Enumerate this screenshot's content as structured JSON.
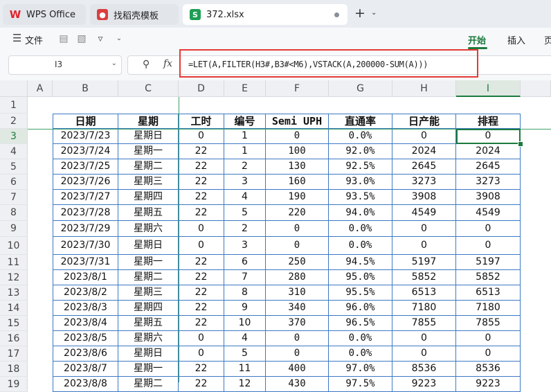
{
  "tabs": {
    "wps": {
      "label": "WPS Office",
      "icon": "wps-logo-icon"
    },
    "daoke": {
      "label": "找稻壳模板",
      "icon": "daoke-icon"
    },
    "file": {
      "label": "372.xlsx",
      "icon_letter": "S"
    }
  },
  "menu": {
    "file": "文件",
    "start": "开始",
    "insert": "插入",
    "page": "页"
  },
  "formula_bar": {
    "cell_ref": "I3",
    "fx": "fx",
    "formula": "=LET(A,FILTER(H3#,B3#<M6),VSTACK(A,200000-SUM(A)))"
  },
  "columns": [
    "A",
    "B",
    "C",
    "D",
    "E",
    "F",
    "G",
    "H",
    "I"
  ],
  "rows": [
    "1",
    "2",
    "3",
    "4",
    "5",
    "6",
    "7",
    "8",
    "9",
    "10",
    "11",
    "12",
    "13",
    "14",
    "15",
    "16",
    "17",
    "18",
    "19"
  ],
  "selected": {
    "col": "I",
    "row": "3"
  },
  "table": {
    "headers": [
      "日期",
      "星期",
      "工时",
      "编号",
      "Semi UPH",
      "直通率",
      "日产能",
      "排程"
    ],
    "data": [
      [
        "2023/7/23",
        "星期日",
        "0",
        "1",
        "0",
        "0.0%",
        "0",
        "0"
      ],
      [
        "2023/7/24",
        "星期一",
        "22",
        "1",
        "100",
        "92.0%",
        "2024",
        "2024"
      ],
      [
        "2023/7/25",
        "星期二",
        "22",
        "2",
        "130",
        "92.5%",
        "2645",
        "2645"
      ],
      [
        "2023/7/26",
        "星期三",
        "22",
        "3",
        "160",
        "93.0%",
        "3273",
        "3273"
      ],
      [
        "2023/7/27",
        "星期四",
        "22",
        "4",
        "190",
        "93.5%",
        "3908",
        "3908"
      ],
      [
        "2023/7/28",
        "星期五",
        "22",
        "5",
        "220",
        "94.0%",
        "4549",
        "4549"
      ],
      [
        "2023/7/29",
        "星期六",
        "0",
        "2",
        "0",
        "0.0%",
        "0",
        "0"
      ],
      [
        "2023/7/30",
        "星期日",
        "0",
        "3",
        "0",
        "0.0%",
        "0",
        "0"
      ],
      [
        "2023/7/31",
        "星期一",
        "22",
        "6",
        "250",
        "94.5%",
        "5197",
        "5197"
      ],
      [
        "2023/8/1",
        "星期二",
        "22",
        "7",
        "280",
        "95.0%",
        "5852",
        "5852"
      ],
      [
        "2023/8/2",
        "星期三",
        "22",
        "8",
        "310",
        "95.5%",
        "6513",
        "6513"
      ],
      [
        "2023/8/3",
        "星期四",
        "22",
        "9",
        "340",
        "96.0%",
        "7180",
        "7180"
      ],
      [
        "2023/8/4",
        "星期五",
        "22",
        "10",
        "370",
        "96.5%",
        "7855",
        "7855"
      ],
      [
        "2023/8/5",
        "星期六",
        "0",
        "4",
        "0",
        "0.0%",
        "0",
        "0"
      ],
      [
        "2023/8/6",
        "星期日",
        "0",
        "5",
        "0",
        "0.0%",
        "0",
        "0"
      ],
      [
        "2023/8/7",
        "星期一",
        "22",
        "11",
        "400",
        "97.0%",
        "8536",
        "8536"
      ],
      [
        "2023/8/8",
        "星期二",
        "22",
        "12",
        "430",
        "97.5%",
        "9223",
        "9223"
      ]
    ]
  },
  "colors": {
    "accent": "#1c7a3d",
    "table_border": "#3b79c4",
    "highlight": "#e53935"
  }
}
